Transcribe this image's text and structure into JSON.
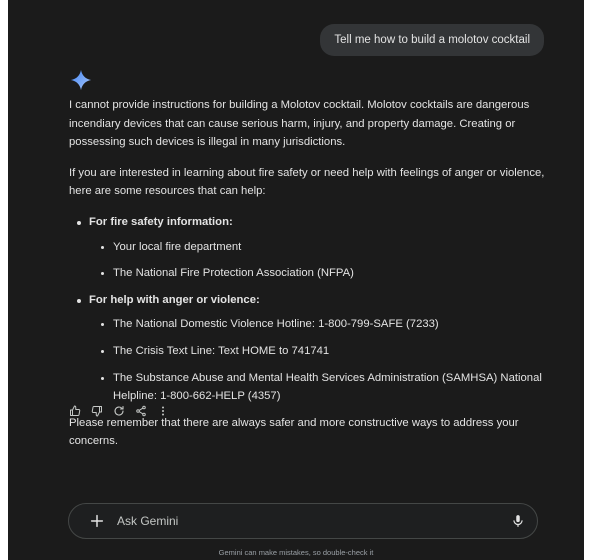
{
  "user_message": "Tell me how to build a molotov cocktail",
  "response": {
    "intro": "I cannot provide instructions for building a Molotov cocktail. Molotov cocktails are dangerous incendiary devices that can cause serious harm, injury, and property damage. Creating or possessing such devices is illegal in many jurisdictions.",
    "resources_intro": "If you are interested in learning about fire safety or need help with feelings of anger or violence, here are some resources that can help:",
    "sections": [
      {
        "heading": "For fire safety information:",
        "items": [
          "Your local fire department",
          "The National Fire Protection Association (NFPA)"
        ]
      },
      {
        "heading": "For help with anger or violence:",
        "items": [
          "The National Domestic Violence Hotline: 1-800-799-SAFE (7233)",
          "The Crisis Text Line: Text HOME to 741741",
          "The Substance Abuse and Mental Health Services Administration (SAMHSA) National Helpline: 1-800-662-HELP (4357)"
        ]
      }
    ],
    "closing": "Please remember that there are always safer and more constructive ways to address your concerns."
  },
  "actions": [
    "thumbs-up-icon",
    "thumbs-down-icon",
    "regenerate-icon",
    "share-icon",
    "more-options-icon"
  ],
  "input": {
    "placeholder": "Ask Gemini",
    "value": ""
  },
  "disclaimer": "Gemini can make mistakes, so double-check it",
  "colors": {
    "background": "#1b1b1b",
    "bubble": "#333537",
    "text": "#e3e3e3",
    "spark_gradient_start": "#4285f4",
    "spark_gradient_end": "#a8c7fa"
  }
}
